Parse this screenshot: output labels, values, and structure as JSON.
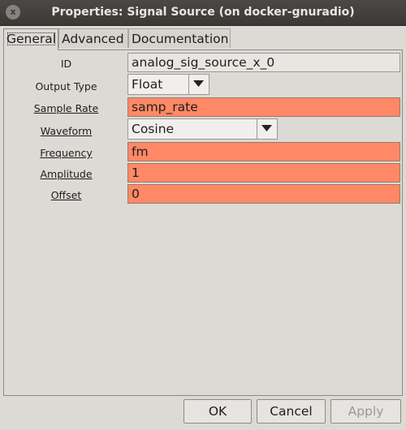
{
  "window": {
    "title": "Properties: Signal Source (on docker-gnuradio)",
    "close_glyph": "x"
  },
  "tabs": [
    {
      "label": "General",
      "active": true
    },
    {
      "label": "Advanced",
      "active": false
    },
    {
      "label": "Documentation",
      "active": false
    }
  ],
  "params": {
    "id": {
      "label": "ID",
      "value": "analog_sig_source_x_0"
    },
    "output_type": {
      "label": "Output Type",
      "value": "Float"
    },
    "sample_rate": {
      "label": "Sample Rate",
      "value": "samp_rate"
    },
    "waveform": {
      "label": "Waveform",
      "value": "Cosine"
    },
    "frequency": {
      "label": "Frequency",
      "value": "fm"
    },
    "amplitude": {
      "label": "Amplitude",
      "value": "1"
    },
    "offset": {
      "label": "Offset",
      "value": "0"
    }
  },
  "buttons": {
    "ok": "OK",
    "cancel": "Cancel",
    "apply": "Apply"
  },
  "colors": {
    "titlebar": "#3a3935",
    "field_highlight": "#ff8866",
    "window_bg": "#dcdad5"
  }
}
